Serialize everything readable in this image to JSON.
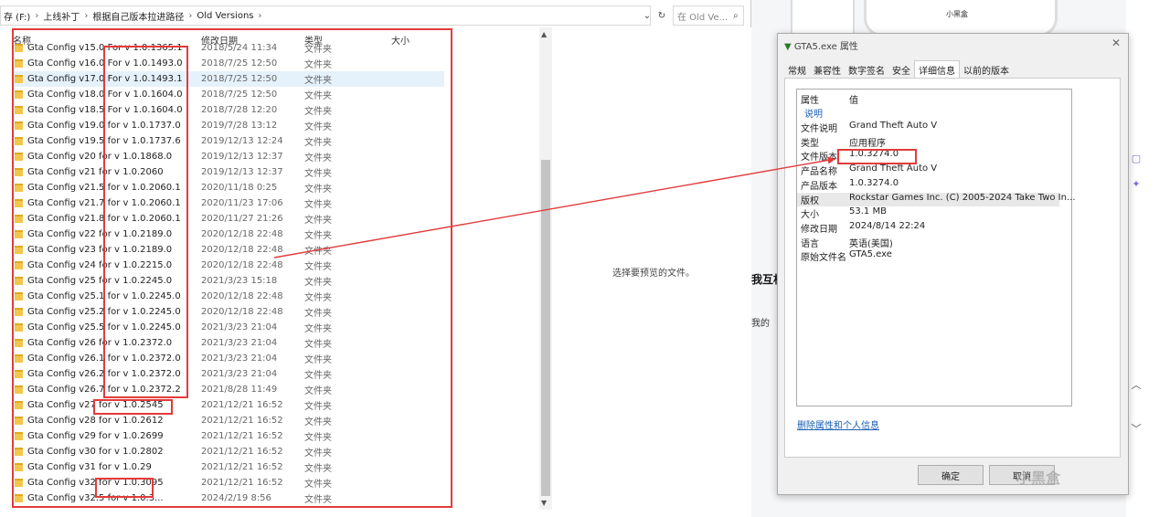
{
  "explorer": {
    "breadcrumb": [
      "存 (F:)",
      "上线补丁",
      "根据自己版本拉进路径",
      "Old Versions"
    ],
    "search_placeholder": "在 Old Ve...",
    "columns": {
      "name": "名称",
      "date": "修改日期",
      "type": "类型",
      "size": "大小"
    },
    "rows": [
      {
        "name": "Gta Config v15.0 For v 1.0.1365.1",
        "date": "2018/5/24 11:34",
        "type": "文件夹"
      },
      {
        "name": "Gta Config v16.0 For v 1.0.1493.0",
        "date": "2018/7/25 12:50",
        "type": "文件夹"
      },
      {
        "name": "Gta Config v17.0 For v 1.0.1493.1",
        "date": "2018/7/25 12:50",
        "type": "文件夹"
      },
      {
        "name": "Gta Config v18.0 For v 1.0.1604.0",
        "date": "2018/7/25 12:50",
        "type": "文件夹"
      },
      {
        "name": "Gta Config v18.5 For v 1.0.1604.0",
        "date": "2018/7/28 12:20",
        "type": "文件夹"
      },
      {
        "name": "Gta Config v19.0 for v 1.0.1737.0",
        "date": "2019/7/28 13:12",
        "type": "文件夹"
      },
      {
        "name": "Gta Config v19.5 for v 1.0.1737.6",
        "date": "2019/12/13 12:24",
        "type": "文件夹"
      },
      {
        "name": "Gta Config v20 for v 1.0.1868.0",
        "date": "2019/12/13 12:37",
        "type": "文件夹"
      },
      {
        "name": "Gta Config v21 for v 1.0.2060",
        "date": "2019/12/13 12:37",
        "type": "文件夹"
      },
      {
        "name": "Gta Config v21.5 for v 1.0.2060.1",
        "date": "2020/11/18 0:25",
        "type": "文件夹"
      },
      {
        "name": "Gta Config v21.7 for v 1.0.2060.1",
        "date": "2020/11/23 17:06",
        "type": "文件夹"
      },
      {
        "name": "Gta Config v21.8 for v 1.0.2060.1",
        "date": "2020/11/27 21:26",
        "type": "文件夹"
      },
      {
        "name": "Gta Config v22 for v 1.0.2189.0",
        "date": "2020/12/18 22:48",
        "type": "文件夹"
      },
      {
        "name": "Gta Config v23 for v 1.0.2189.0",
        "date": "2020/12/18 22:48",
        "type": "文件夹"
      },
      {
        "name": "Gta Config v24 for v 1.0.2215.0",
        "date": "2020/12/18 22:48",
        "type": "文件夹"
      },
      {
        "name": "Gta Config v25 for v 1.0.2245.0",
        "date": "2021/3/23 15:18",
        "type": "文件夹"
      },
      {
        "name": "Gta Config v25.1 for v 1.0.2245.0",
        "date": "2020/12/18 22:48",
        "type": "文件夹"
      },
      {
        "name": "Gta Config v25.2 for v 1.0.2245.0",
        "date": "2020/12/18 22:48",
        "type": "文件夹"
      },
      {
        "name": "Gta Config v25.5 for v 1.0.2245.0",
        "date": "2021/3/23 21:04",
        "type": "文件夹"
      },
      {
        "name": "Gta Config v26 for v 1.0.2372.0",
        "date": "2021/3/23 21:04",
        "type": "文件夹"
      },
      {
        "name": "Gta Config v26.1 for v 1.0.2372.0",
        "date": "2021/3/23 21:04",
        "type": "文件夹"
      },
      {
        "name": "Gta Config v26.2 for v 1.0.2372.0",
        "date": "2021/3/23 21:04",
        "type": "文件夹"
      },
      {
        "name": "Gta Config v26.7 for v 1.0.2372.2",
        "date": "2021/8/28 11:49",
        "type": "文件夹"
      },
      {
        "name": "Gta Config v27 for v 1.0.2545",
        "date": "2021/12/21 16:52",
        "type": "文件夹"
      },
      {
        "name": "Gta Config v28 for v 1.0.2612",
        "date": "2021/12/21 16:52",
        "type": "文件夹"
      },
      {
        "name": "Gta Config v29 for v 1.0.2699",
        "date": "2021/12/21 16:52",
        "type": "文件夹"
      },
      {
        "name": "Gta Config v30 for v 1.0.2802",
        "date": "2021/12/21 16:52",
        "type": "文件夹"
      },
      {
        "name": "Gta Config v31 for v 1.0.29",
        "date": "2021/12/21 16:52",
        "type": "文件夹"
      },
      {
        "name": "Gta Config v32 for v 1.0.3095",
        "date": "2021/12/21 16:52",
        "type": "文件夹"
      },
      {
        "name": "Gta Config v32.5 for v 1.0.3...",
        "date": "2024/2/19 8:56",
        "type": "文件夹"
      }
    ],
    "preview_text": "选择要预览的文件。"
  },
  "background": {
    "phone_label": "小黑盒",
    "text1": "我互相",
    "text2": "我的"
  },
  "dialog": {
    "title": "GTA5.exe 属性",
    "tabs": [
      "常规",
      "兼容性",
      "数字签名",
      "安全",
      "详细信息",
      "以前的版本"
    ],
    "active_tab": "详细信息",
    "header": {
      "k": "属性",
      "v": "值"
    },
    "section": "说明",
    "props": [
      {
        "k": "文件说明",
        "v": "Grand Theft Auto V"
      },
      {
        "k": "类型",
        "v": "应用程序"
      },
      {
        "k": "文件版本",
        "v": "1.0.3274.0"
      },
      {
        "k": "产品名称",
        "v": "Grand Theft Auto V"
      },
      {
        "k": "产品版本",
        "v": "1.0.3274.0"
      },
      {
        "k": "版权",
        "v": "Rockstar Games Inc. (C) 2005-2024 Take Two In..."
      },
      {
        "k": "大小",
        "v": "53.1 MB"
      },
      {
        "k": "修改日期",
        "v": "2024/8/14 22:24"
      },
      {
        "k": "语言",
        "v": "英语(美国)"
      },
      {
        "k": "原始文件名",
        "v": "GTA5.exe"
      }
    ],
    "link": "删除属性和个人信息",
    "ok": "确定",
    "cancel": "取消"
  },
  "watermark": "小黑盒",
  "colors": {
    "annotation_red": "#e23b3b",
    "selection": "#e5f1fb",
    "link": "#1a5fb4"
  }
}
